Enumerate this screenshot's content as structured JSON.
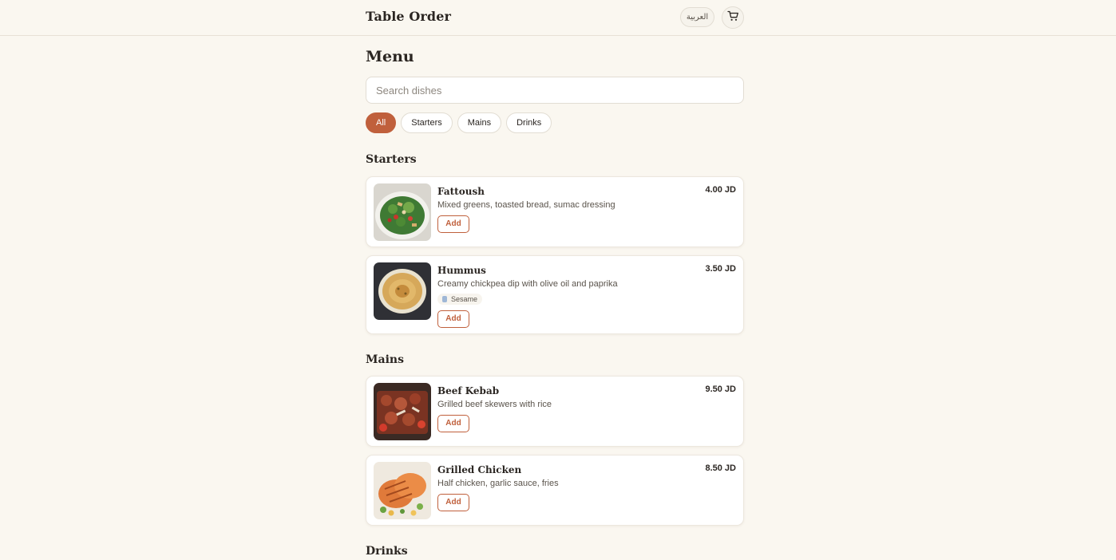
{
  "header": {
    "brand": "Table Order",
    "language_label": "العربية",
    "cart_icon": "cart-icon"
  },
  "page_title": "Menu",
  "search": {
    "placeholder": "Search dishes",
    "value": ""
  },
  "categories": [
    {
      "label": "All",
      "active": true
    },
    {
      "label": "Starters",
      "active": false
    },
    {
      "label": "Mains",
      "active": false
    },
    {
      "label": "Drinks",
      "active": false
    }
  ],
  "sections": [
    {
      "title": "Starters",
      "items": [
        {
          "name": "Fattoush",
          "description": "Mixed greens, toasted bread, sumac dressing",
          "price": "4.00 JD",
          "add_label": "Add",
          "allergens": []
        },
        {
          "name": "Hummus",
          "description": "Creamy chickpea dip with olive oil and paprika",
          "price": "3.50 JD",
          "add_label": "Add",
          "allergens": [
            "Sesame"
          ]
        }
      ]
    },
    {
      "title": "Mains",
      "items": [
        {
          "name": "Beef Kebab",
          "description": "Grilled beef skewers with rice",
          "price": "9.50 JD",
          "add_label": "Add",
          "allergens": []
        },
        {
          "name": "Grilled Chicken",
          "description": "Half chicken, garlic sauce, fries",
          "price": "8.50 JD",
          "add_label": "Add",
          "allergens": []
        }
      ]
    },
    {
      "title": "Drinks",
      "items": []
    }
  ],
  "colors": {
    "accent": "#c0603c",
    "background": "#faf7f0",
    "card": "#ffffff"
  }
}
